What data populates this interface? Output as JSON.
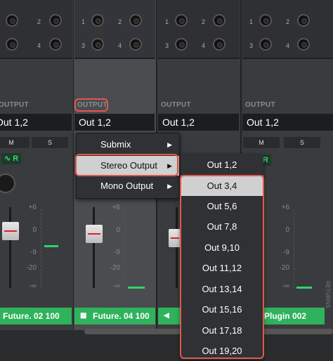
{
  "channels": [
    {
      "output_label": "OUTPUT",
      "output_value": "Out 1,2",
      "name": "Future. 02 100"
    },
    {
      "output_label": "OUTPUT",
      "output_value": "Out 1,2",
      "name": "Future. 04 100"
    },
    {
      "output_label": "OUTPUT",
      "output_value": "Out 1,2",
      "name": ""
    },
    {
      "output_label": "OUTPUT",
      "output_value": "Out 1,2",
      "name": "Plugin 002"
    }
  ],
  "jack_numbers": [
    "1",
    "2",
    "3",
    "4"
  ],
  "buttons": {
    "mute": "M",
    "solo": "S",
    "record": "R"
  },
  "fader_scale": [
    "+6",
    "0",
    "-9",
    "-20",
    "-∞"
  ],
  "output_menu": {
    "items": [
      {
        "label": "Submix",
        "arrow": "▶"
      },
      {
        "label": "Stereo Output",
        "arrow": "▶"
      },
      {
        "label": "Mono Output",
        "arrow": "▶"
      }
    ]
  },
  "stereo_submenu": {
    "items": [
      "Out 1,2",
      "Out 3,4",
      "Out 5,6",
      "Out 7,8",
      "Out 9,10",
      "Out 11,12",
      "Out 13,14",
      "Out 15,16",
      "Out 17,18",
      "Out 19,20"
    ],
    "selected": "Out 3,4"
  },
  "returns_label": "RETURNS",
  "colors": {
    "accent_green": "#2fb25c",
    "highlight_red": "#e2584c"
  }
}
